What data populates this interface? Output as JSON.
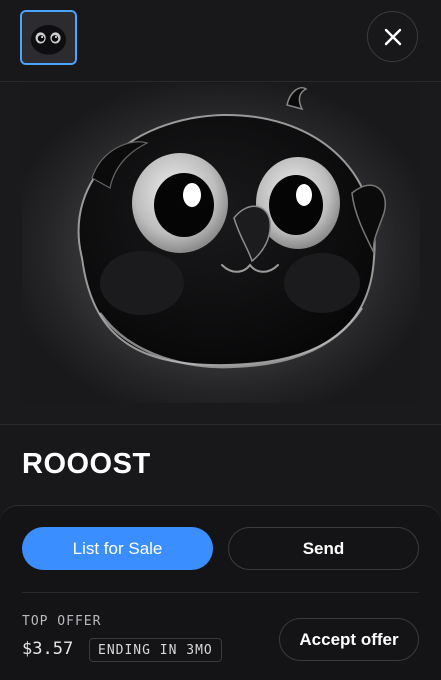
{
  "header": {
    "thumbnail_icon": "bird-thumbnail",
    "close_icon": "close-icon"
  },
  "nft": {
    "title": "ROOOST",
    "image": "black-bird-artwork"
  },
  "actions": {
    "list_for_sale_label": "List for Sale",
    "send_label": "Send"
  },
  "offer": {
    "label": "TOP OFFER",
    "price": "$3.57",
    "ending": "ENDING IN 3MO",
    "accept_label": "Accept offer"
  },
  "colors": {
    "background": "#18181b",
    "panel": "#141416",
    "accent": "#3b8eff",
    "selected_border": "#4aa3ff"
  }
}
